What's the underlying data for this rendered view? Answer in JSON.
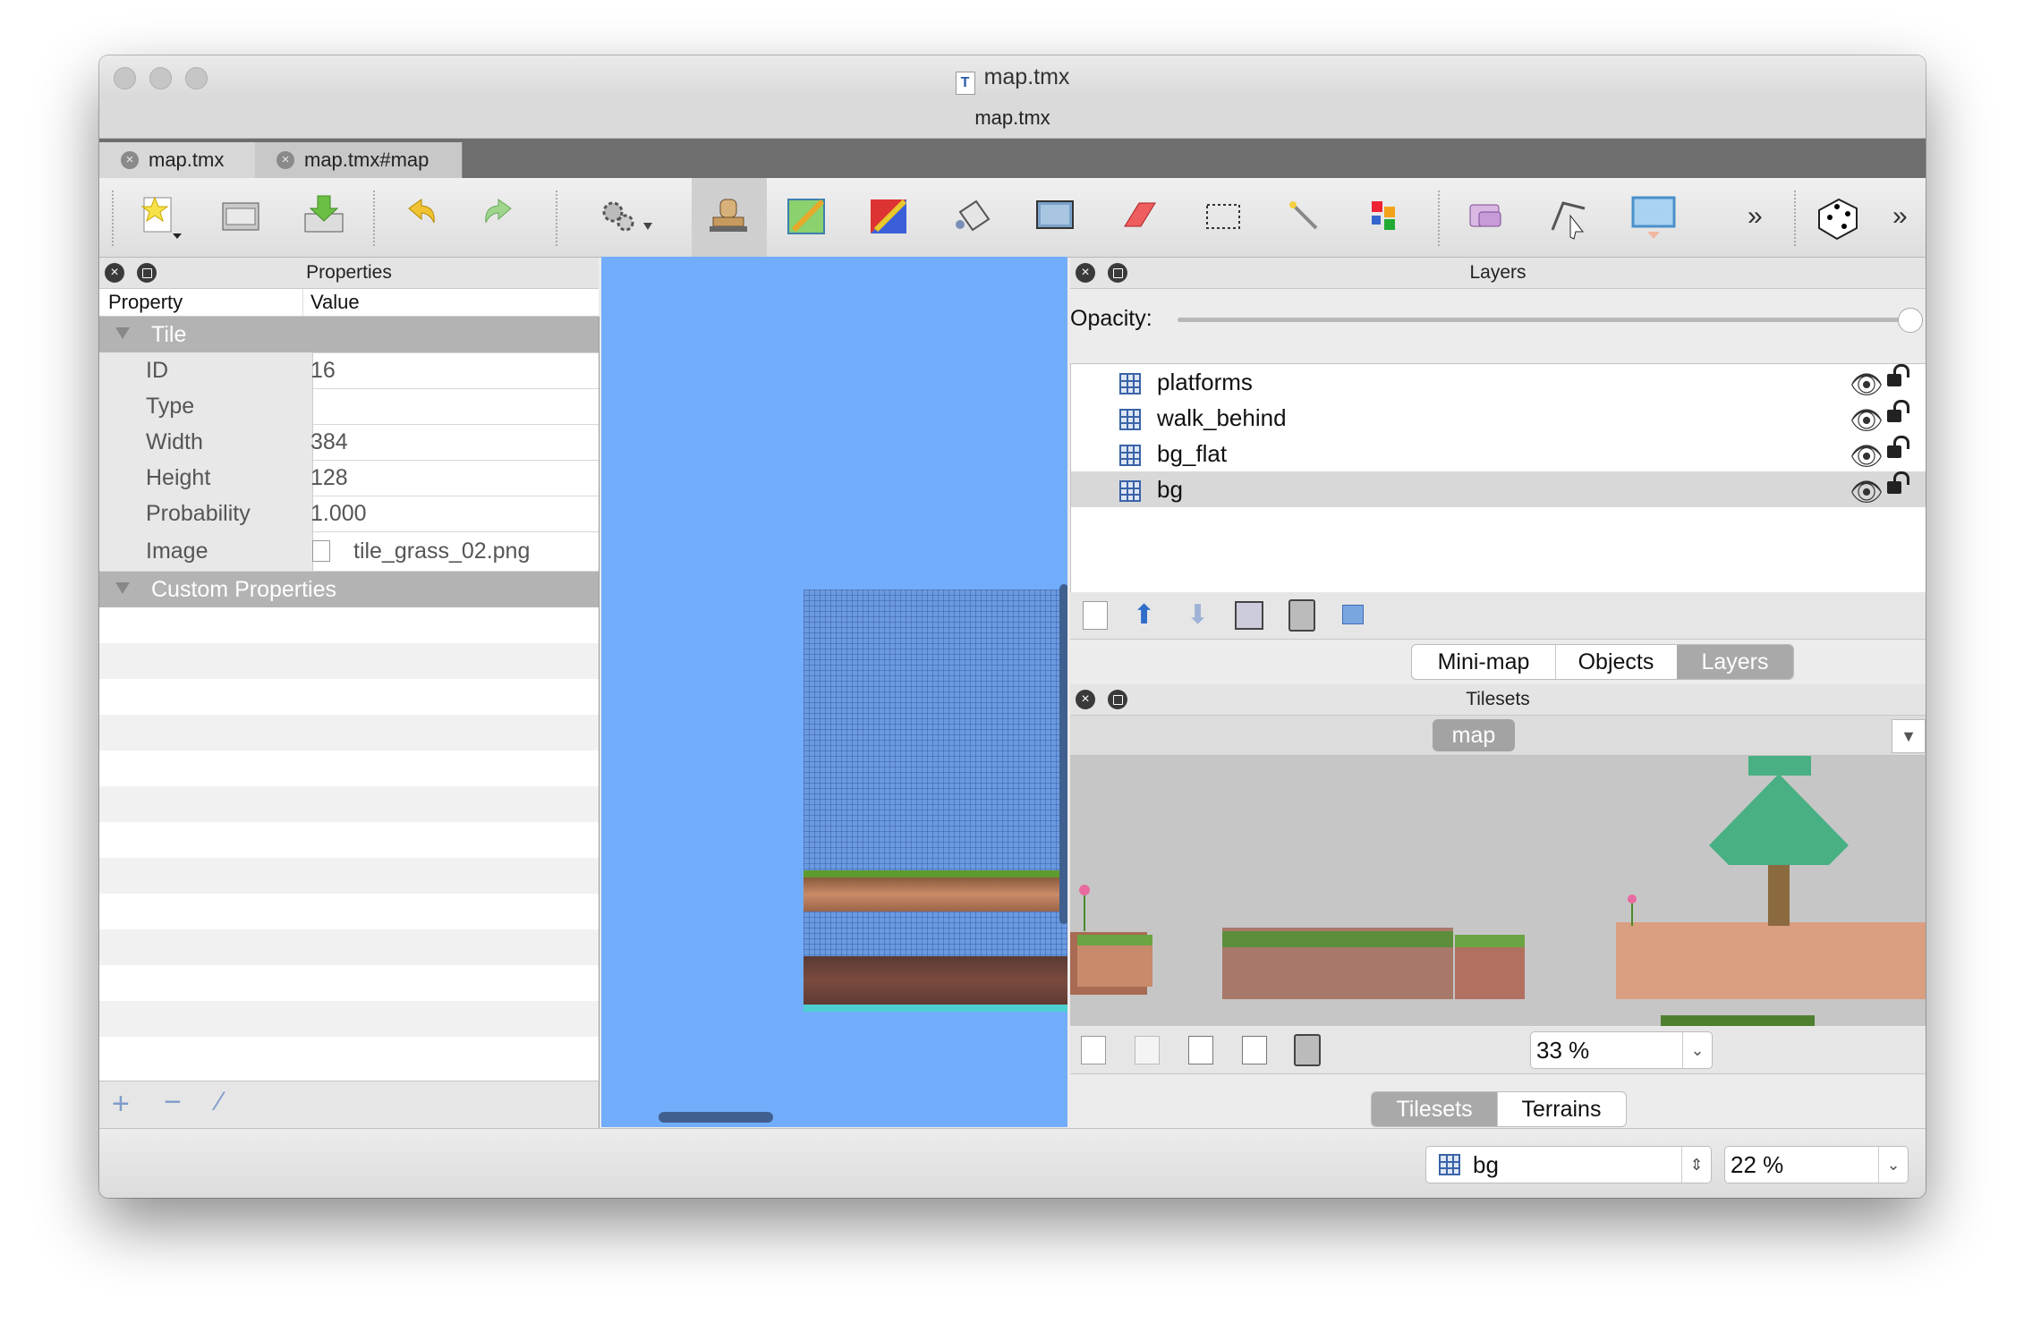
{
  "window": {
    "title": "map.tmx",
    "subtitle": "map.tmx"
  },
  "doc_tabs": [
    {
      "label": "map.tmx"
    },
    {
      "label": "map.tmx#map"
    }
  ],
  "toolbar": {
    "icons": [
      "new-document-icon",
      "open-folder-icon",
      "save-icon",
      "undo-icon",
      "redo-icon",
      "commands-gear-icon",
      "stamp-brush-icon",
      "terrain-brush-icon",
      "wang-brush-icon",
      "bucket-fill-icon",
      "shape-fill-icon",
      "eraser-icon",
      "rectangle-select-icon",
      "magic-wand-icon",
      "select-same-tile-icon",
      "insert-rectangle-icon",
      "edit-polygons-icon",
      "insert-tile-icon",
      "more-chevron-icon",
      "random-dice-icon",
      "more-chevron-icon"
    ],
    "overflow": "»"
  },
  "properties_panel": {
    "title": "Properties",
    "col_property": "Property",
    "col_value": "Value",
    "group_tile": "Tile",
    "rows": [
      {
        "key": "ID",
        "value": "16"
      },
      {
        "key": "Type",
        "value": ""
      },
      {
        "key": "Width",
        "value": "384"
      },
      {
        "key": "Height",
        "value": "128"
      },
      {
        "key": "Probability",
        "value": "1.000"
      },
      {
        "key": "Image",
        "value": "tile_grass_02.png"
      }
    ],
    "group_custom": "Custom Properties"
  },
  "layers_panel": {
    "title": "Layers",
    "opacity_label": "Opacity:",
    "opacity_value": 1.0,
    "layers": [
      {
        "name": "platforms",
        "selected": false
      },
      {
        "name": "walk_behind",
        "selected": false
      },
      {
        "name": "bg_flat",
        "selected": false
      },
      {
        "name": "bg",
        "selected": true
      }
    ],
    "tabs": [
      "Mini-map",
      "Objects",
      "Layers"
    ],
    "active_tab": "Layers"
  },
  "tilesets_panel": {
    "title": "Tilesets",
    "tileset_tab": "map",
    "zoom": "33 %",
    "tabs": [
      "Tilesets",
      "Terrains"
    ],
    "active_tab": "Tilesets"
  },
  "statusbar": {
    "layer": "bg",
    "zoom": "22 %"
  },
  "colors": {
    "canvas_bg": "#72adfb",
    "selection": "#a9a9a9"
  }
}
